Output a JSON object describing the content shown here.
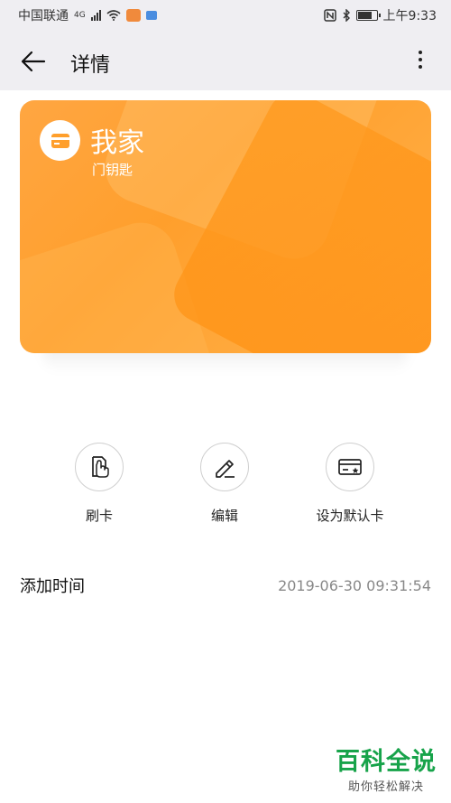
{
  "status_bar": {
    "carrier": "中国联通",
    "network": "4G",
    "time": "上午9:33"
  },
  "app_bar": {
    "title": "详情",
    "back_icon": "arrow-left-icon",
    "more_icon": "more-vertical-icon"
  },
  "card": {
    "name": "我家",
    "type": "门钥匙",
    "icon": "card-icon",
    "colors": {
      "primary": "#ff9f2c",
      "secondary": "#ffb24c"
    }
  },
  "actions": [
    {
      "label": "刷卡",
      "icon": "swipe-card-icon"
    },
    {
      "label": "编辑",
      "icon": "pencil-icon"
    },
    {
      "label": "设为默认卡",
      "icon": "default-card-icon"
    }
  ],
  "details": {
    "added_time_label": "添加时间",
    "added_time_value": "2019-06-30 09:31:54"
  },
  "watermark": {
    "title": "百科全说",
    "subtitle": "助你轻松解决"
  }
}
